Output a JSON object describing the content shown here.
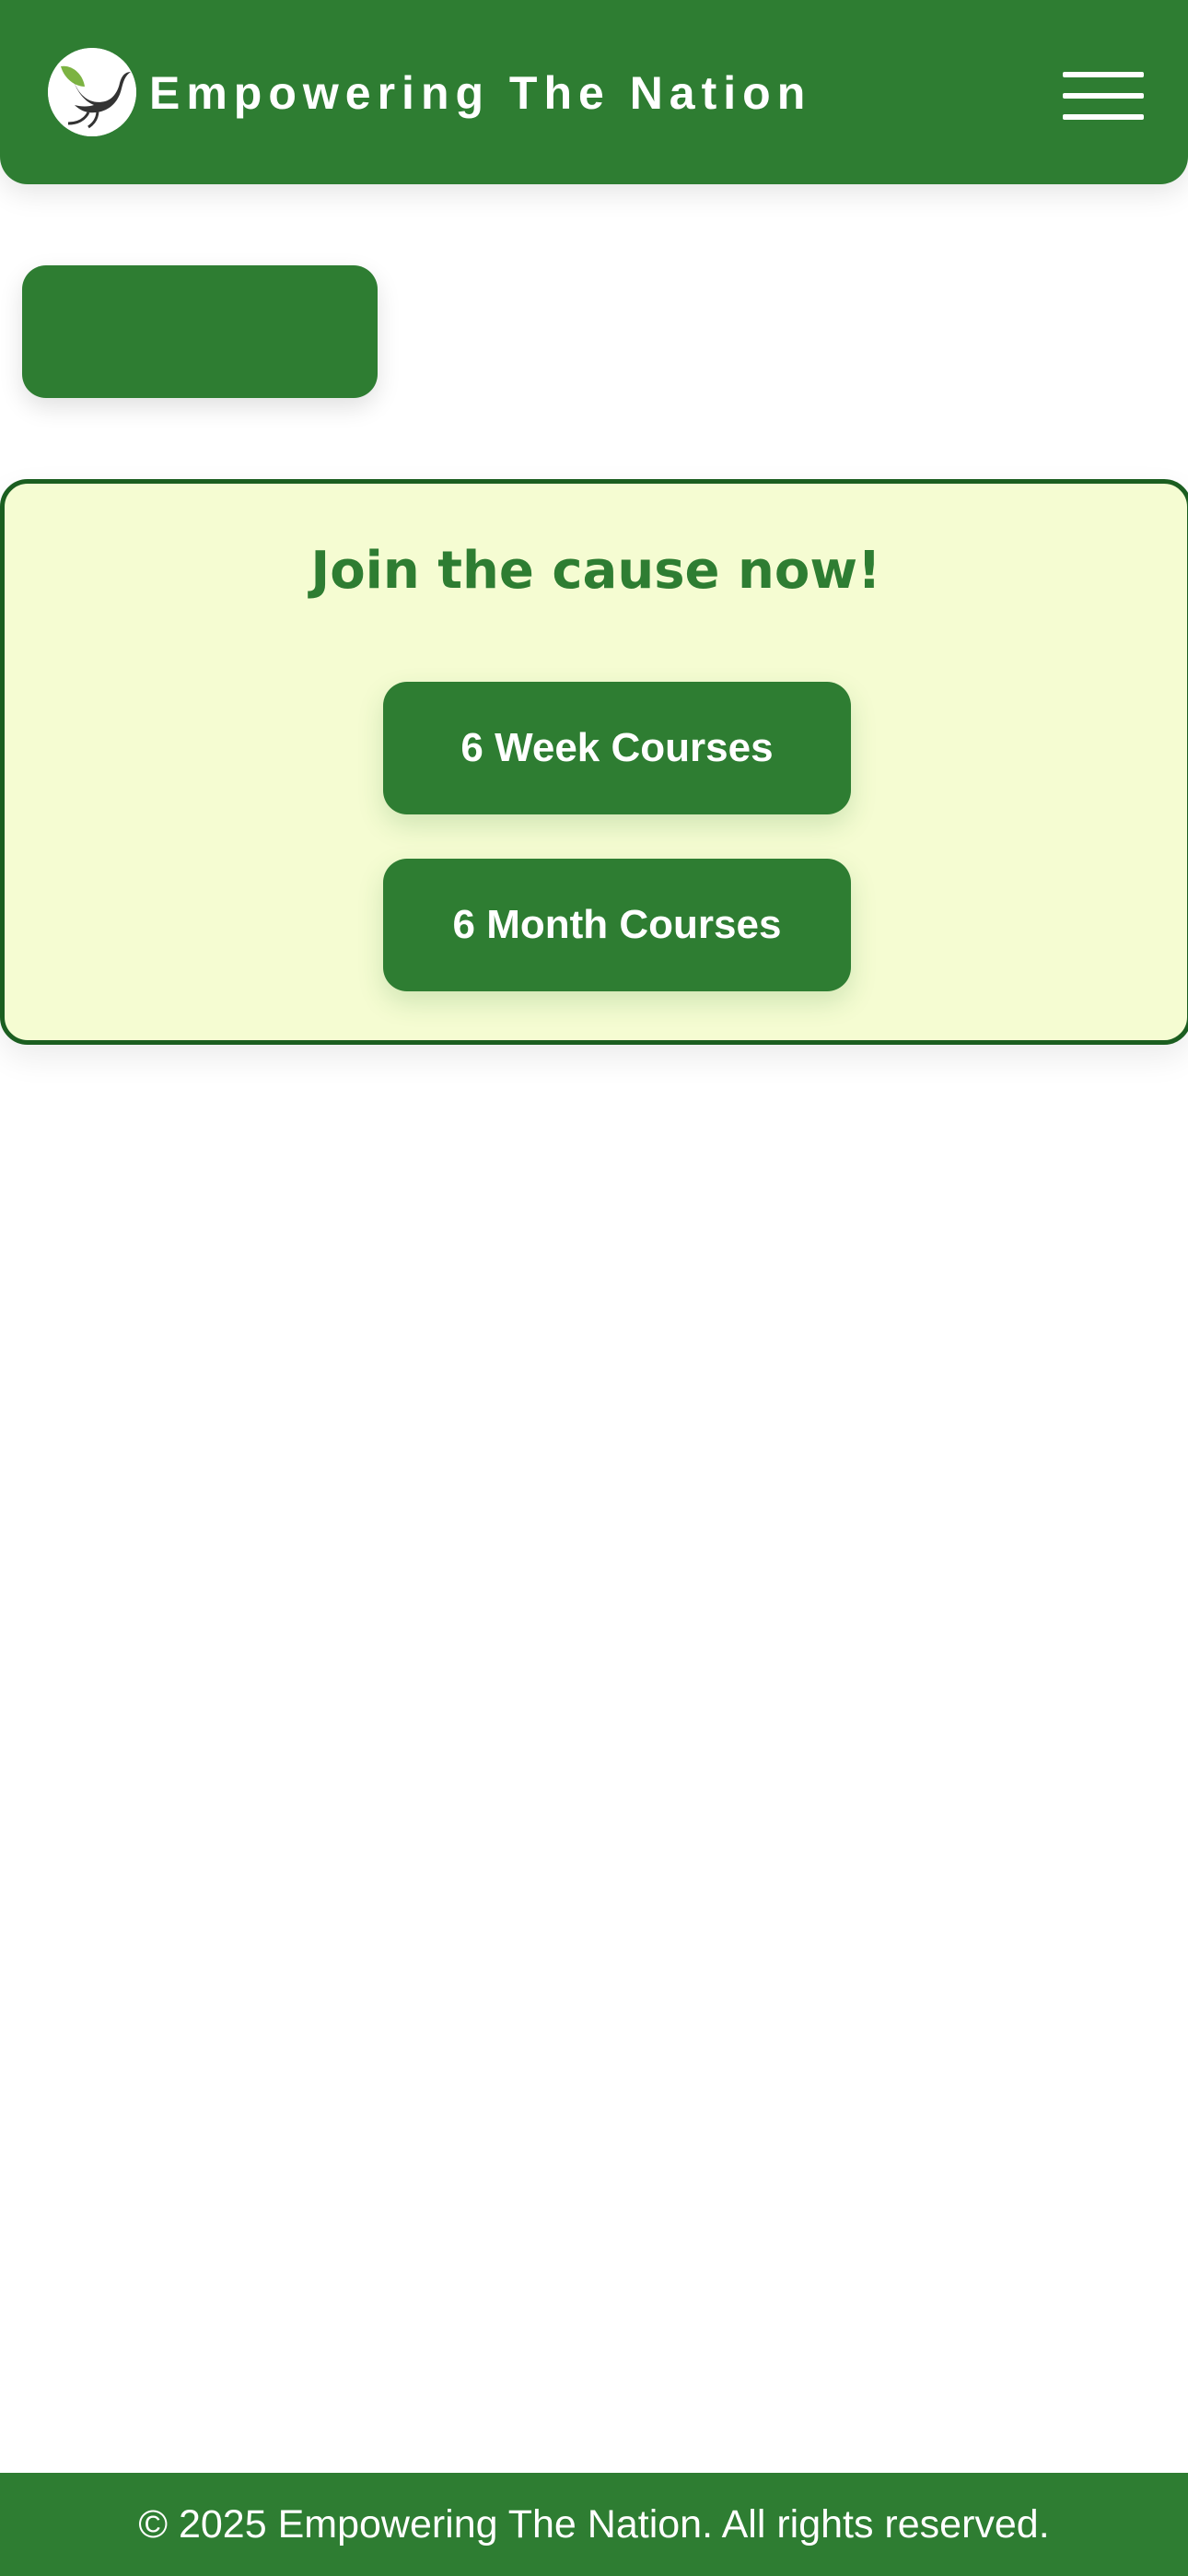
{
  "header": {
    "brand_title": "Empowering The Nation",
    "logo_icon": "dove-leaf-logo",
    "menu_icon": "hamburger-menu-icon"
  },
  "back_button": {
    "icon": "chevron-left-icon"
  },
  "card": {
    "title": "Join the cause now!",
    "buttons": [
      {
        "label": "6 Week Courses"
      },
      {
        "label": "6 Month Courses"
      }
    ]
  },
  "footer": {
    "text": "© 2025 Empowering The Nation. All rights reserved."
  },
  "colors": {
    "primary": "#2e7d32",
    "card_background": "#f5fcd2",
    "card_border": "#1b5e20",
    "text_on_primary": "#ffffff"
  }
}
